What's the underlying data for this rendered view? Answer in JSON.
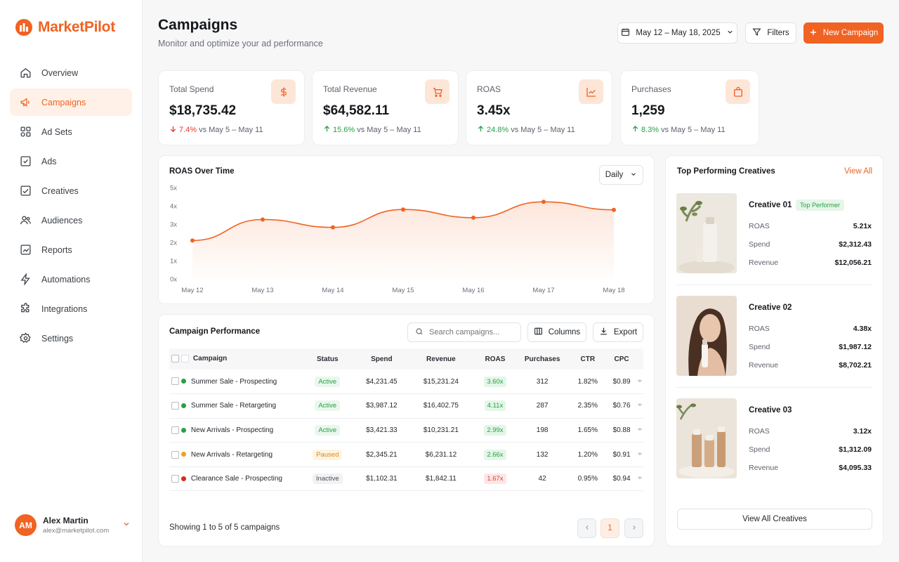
{
  "app": {
    "name": "MarketPilot",
    "brand_color": "#f06322"
  },
  "sidebar": {
    "items": [
      {
        "label": "Overview",
        "icon": "home-icon"
      },
      {
        "label": "Campaigns",
        "icon": "megaphone-icon"
      },
      {
        "label": "Ad Sets",
        "icon": "grid-icon"
      },
      {
        "label": "Ads",
        "icon": "square-check-icon"
      },
      {
        "label": "Creatives",
        "icon": "image-check-icon"
      },
      {
        "label": "Audiences",
        "icon": "users-icon"
      },
      {
        "label": "Reports",
        "icon": "chart-icon"
      },
      {
        "label": "Automations",
        "icon": "lightning-icon"
      },
      {
        "label": "Integrations",
        "icon": "puzzle-icon"
      },
      {
        "label": "Settings",
        "icon": "gear-icon"
      }
    ],
    "active": "Campaigns"
  },
  "user": {
    "initials": "AM",
    "name": "Alex Martin",
    "email": "alex@marketpilot.com"
  },
  "header": {
    "title": "Campaigns",
    "subtitle": "Monitor and optimize your ad performance",
    "date_range": "May 12 – May 18, 2025",
    "filters_label": "Filters",
    "new_campaign_label": "New Campaign"
  },
  "kpis": [
    {
      "label": "Total Spend",
      "value": "$18,735.42",
      "change": "7.4%",
      "direction": "down",
      "compare": "vs May 5 – May 11",
      "icon": "dollar-icon"
    },
    {
      "label": "Total Revenue",
      "value": "$64,582.11",
      "change": "15.6%",
      "direction": "up",
      "compare": "vs May 5 – May 11",
      "icon": "cart-icon"
    },
    {
      "label": "ROAS",
      "value": "3.45x",
      "change": "24.8%",
      "direction": "up",
      "compare": "vs May 5 – May 11",
      "icon": "trend-icon"
    },
    {
      "label": "Purchases",
      "value": "1,259",
      "change": "8.3%",
      "direction": "up",
      "compare": "vs May 5 – May 11",
      "icon": "bag-icon"
    }
  ],
  "roas_chart": {
    "title": "ROAS Over Time",
    "granularity": "Daily"
  },
  "chart_data": {
    "type": "area",
    "title": "ROAS Over Time",
    "x": [
      "May 12",
      "May 13",
      "May 14",
      "May 15",
      "May 16",
      "May 17",
      "May 18"
    ],
    "y_ticks": [
      "0x",
      "1x",
      "2x",
      "3x",
      "4x",
      "5x"
    ],
    "ylim": [
      0,
      5
    ],
    "series": [
      {
        "values": [
          2.1,
          3.25,
          2.82,
          3.8,
          3.35,
          4.22,
          3.78
        ]
      }
    ],
    "grid": false,
    "color": "#f06322"
  },
  "campaigns_table": {
    "title": "Campaign Performance",
    "search_placeholder": "Search campaigns...",
    "columns_label": "Columns",
    "export_label": "Export",
    "headers": [
      "Campaign",
      "Status",
      "Spend",
      "Revenue",
      "ROAS",
      "Purchases",
      "CTR",
      "CPC"
    ],
    "rows": [
      {
        "name": "Summer Sale - Prospecting",
        "status": "Active",
        "spend": "$4,231.45",
        "revenue": "$15,231.24",
        "roas": "3.60x",
        "purchases": "312",
        "ctr": "1.82%",
        "cpc": "$0.89",
        "dot": "#27a046",
        "roas_tone": "green"
      },
      {
        "name": "Summer Sale - Retargeting",
        "status": "Active",
        "spend": "$3,987.12",
        "revenue": "$16,402.75",
        "roas": "4.11x",
        "purchases": "287",
        "ctr": "2.35%",
        "cpc": "$0.76",
        "dot": "#27a046",
        "roas_tone": "green"
      },
      {
        "name": "New Arrivals - Prospecting",
        "status": "Active",
        "spend": "$3,421.33",
        "revenue": "$10,231.21",
        "roas": "2.99x",
        "purchases": "198",
        "ctr": "1.65%",
        "cpc": "$0.88",
        "dot": "#27a046",
        "roas_tone": "green"
      },
      {
        "name": "New Arrivals - Retargeting",
        "status": "Paused",
        "spend": "$2,345.21",
        "revenue": "$6,231.12",
        "roas": "2.66x",
        "purchases": "132",
        "ctr": "1.20%",
        "cpc": "$0.91",
        "dot": "#f0a21c",
        "roas_tone": "green"
      },
      {
        "name": "Clearance Sale - Prospecting",
        "status": "Inactive",
        "spend": "$1,102.31",
        "revenue": "$1,842.11",
        "roas": "1.67x",
        "purchases": "42",
        "ctr": "0.95%",
        "cpc": "$0.94",
        "dot": "#d62a1f",
        "roas_tone": "red"
      }
    ],
    "footer": "Showing 1 to 5 of 5 campaigns",
    "current_page": "1"
  },
  "creatives": {
    "title": "Top Performing Creatives",
    "view_all_link": "View All",
    "view_all_button": "View All Creatives",
    "items": [
      {
        "name": "Creative 01",
        "badge": "Top Performer",
        "roas_label": "ROAS",
        "roas": "5.21x",
        "spend_label": "Spend",
        "spend": "$2,312.43",
        "revenue_label": "Revenue",
        "revenue": "$12,056.21"
      },
      {
        "name": "Creative 02",
        "badge": "",
        "roas_label": "ROAS",
        "roas": "4.38x",
        "spend_label": "Spend",
        "spend": "$1,987.12",
        "revenue_label": "Revenue",
        "revenue": "$8,702.21"
      },
      {
        "name": "Creative 03",
        "badge": "",
        "roas_label": "ROAS",
        "roas": "3.12x",
        "spend_label": "Spend",
        "spend": "$1,312.09",
        "revenue_label": "Revenue",
        "revenue": "$4,095.33"
      }
    ]
  }
}
